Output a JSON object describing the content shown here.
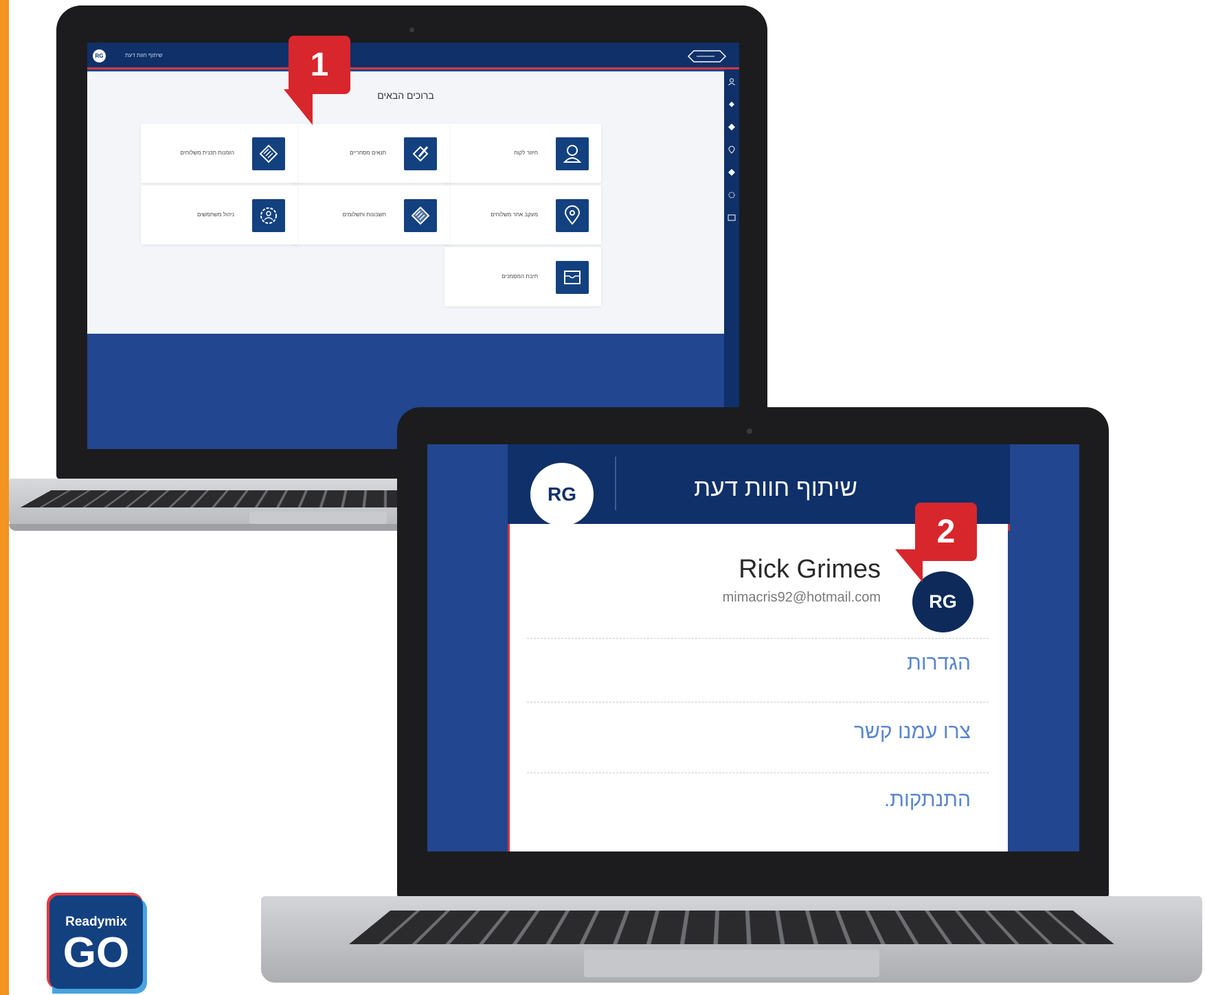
{
  "laptop1": {
    "topbar": {
      "avatar_initials": "RG",
      "title": "שיתוף חוות דעת",
      "logo": "readymix-logo"
    },
    "welcome": "ברוכים הבאים",
    "tiles": [
      {
        "label": "חיזור לקוח",
        "icon": "user-icon"
      },
      {
        "label": "תנאים מסחריים",
        "icon": "pen-tag-icon"
      },
      {
        "label": "הזמנות תכנית משלוחים",
        "icon": "diamond-layers-icon"
      },
      {
        "label": "מעקב אחר משלוחים",
        "icon": "location-pin-icon"
      },
      {
        "label": "חשבונות ותשלומים",
        "icon": "diamond-layers-icon"
      },
      {
        "label": "ניהול משתמשים",
        "icon": "gear-user-icon"
      },
      {
        "label": "תיבת המסמכים",
        "icon": "mailbox-icon"
      }
    ],
    "sidebar_icons": [
      "user-icon",
      "pen-tag-icon",
      "diamond-icon",
      "location-pin-icon",
      "diamond-icon",
      "gear-icon",
      "mailbox-icon"
    ]
  },
  "laptop2": {
    "header": {
      "avatar_initials": "RG",
      "title": "שיתוף חוות דעת"
    },
    "user": {
      "name": "Rick Grimes",
      "email": "mimacris92@hotmail.com",
      "initials": "RG"
    },
    "menu": [
      {
        "label": "הגדרות"
      },
      {
        "label": "צרו עמנו קשר"
      },
      {
        "label": "התנתקות."
      }
    ]
  },
  "callouts": {
    "one": "1",
    "two": "2"
  },
  "logo": {
    "brand": "Readymix",
    "tagline": "GO"
  },
  "colors": {
    "navy": "#0f3069",
    "screen_blue": "#22468f",
    "accent_red": "#d8262d",
    "link_blue": "#5a86cf",
    "orange": "#f39320"
  }
}
